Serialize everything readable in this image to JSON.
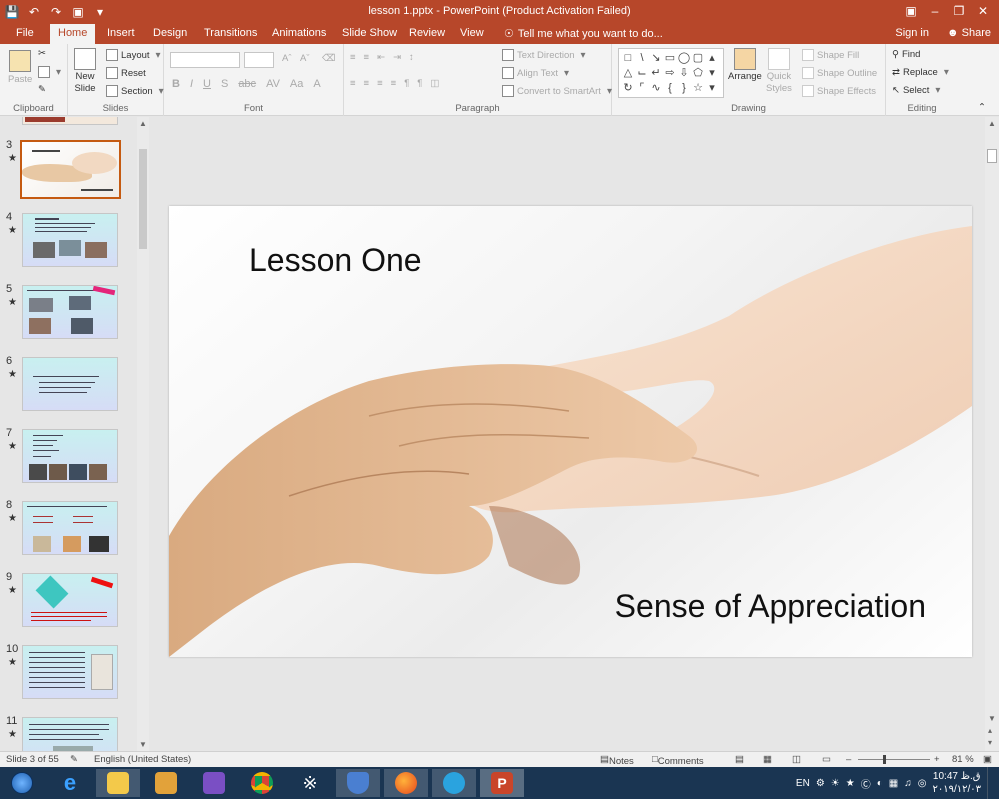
{
  "window": {
    "title": "lesson 1.pptx - PowerPoint (Product Activation Failed)"
  },
  "tabs": [
    "File",
    "Home",
    "Insert",
    "Design",
    "Transitions",
    "Animations",
    "Slide Show",
    "Review",
    "View"
  ],
  "active_tab": "Home",
  "tell_me": "Tell me what you want to do...",
  "account": {
    "sign_in": "Sign in",
    "share": "Share"
  },
  "ribbon": {
    "clipboard": {
      "label": "Clipboard",
      "paste": "Paste"
    },
    "slides": {
      "label": "Slides",
      "new_slide_1": "New",
      "new_slide_2": "Slide",
      "layout": "Layout",
      "reset": "Reset",
      "section": "Section"
    },
    "font": {
      "label": "Font"
    },
    "paragraph": {
      "label": "Paragraph",
      "text_direction": "Text Direction",
      "align_text": "Align Text",
      "smartart": "Convert to SmartArt"
    },
    "drawing": {
      "label": "Drawing",
      "arrange": "Arrange",
      "quick_styles_1": "Quick",
      "quick_styles_2": "Styles",
      "shape_fill": "Shape Fill",
      "shape_outline": "Shape Outline",
      "shape_effects": "Shape Effects"
    },
    "editing": {
      "label": "Editing",
      "find": "Find",
      "replace": "Replace",
      "select": "Select"
    }
  },
  "thumbnails": [
    {
      "num": "3",
      "selected": true
    },
    {
      "num": "4",
      "selected": false
    },
    {
      "num": "5",
      "selected": false
    },
    {
      "num": "6",
      "selected": false
    },
    {
      "num": "7",
      "selected": false
    },
    {
      "num": "8",
      "selected": false
    },
    {
      "num": "9",
      "selected": false
    },
    {
      "num": "10",
      "selected": false
    },
    {
      "num": "11",
      "selected": false
    }
  ],
  "slide": {
    "title": "Lesson One",
    "subtitle": "Sense of Appreciation"
  },
  "status": {
    "slide_info": "Slide 3 of 55",
    "language": "English (United States)",
    "notes": "Notes",
    "comments": "Comments",
    "zoom": "81 %"
  },
  "taskbar": {
    "lang": "EN",
    "time": "10:47 ق.ظ",
    "date": "۲۰۱۹/۱۲/۰۳"
  },
  "colors": {
    "accent": "#b7472a",
    "taskbar": "#1a3552",
    "selected_thumb": "#c55a11"
  }
}
